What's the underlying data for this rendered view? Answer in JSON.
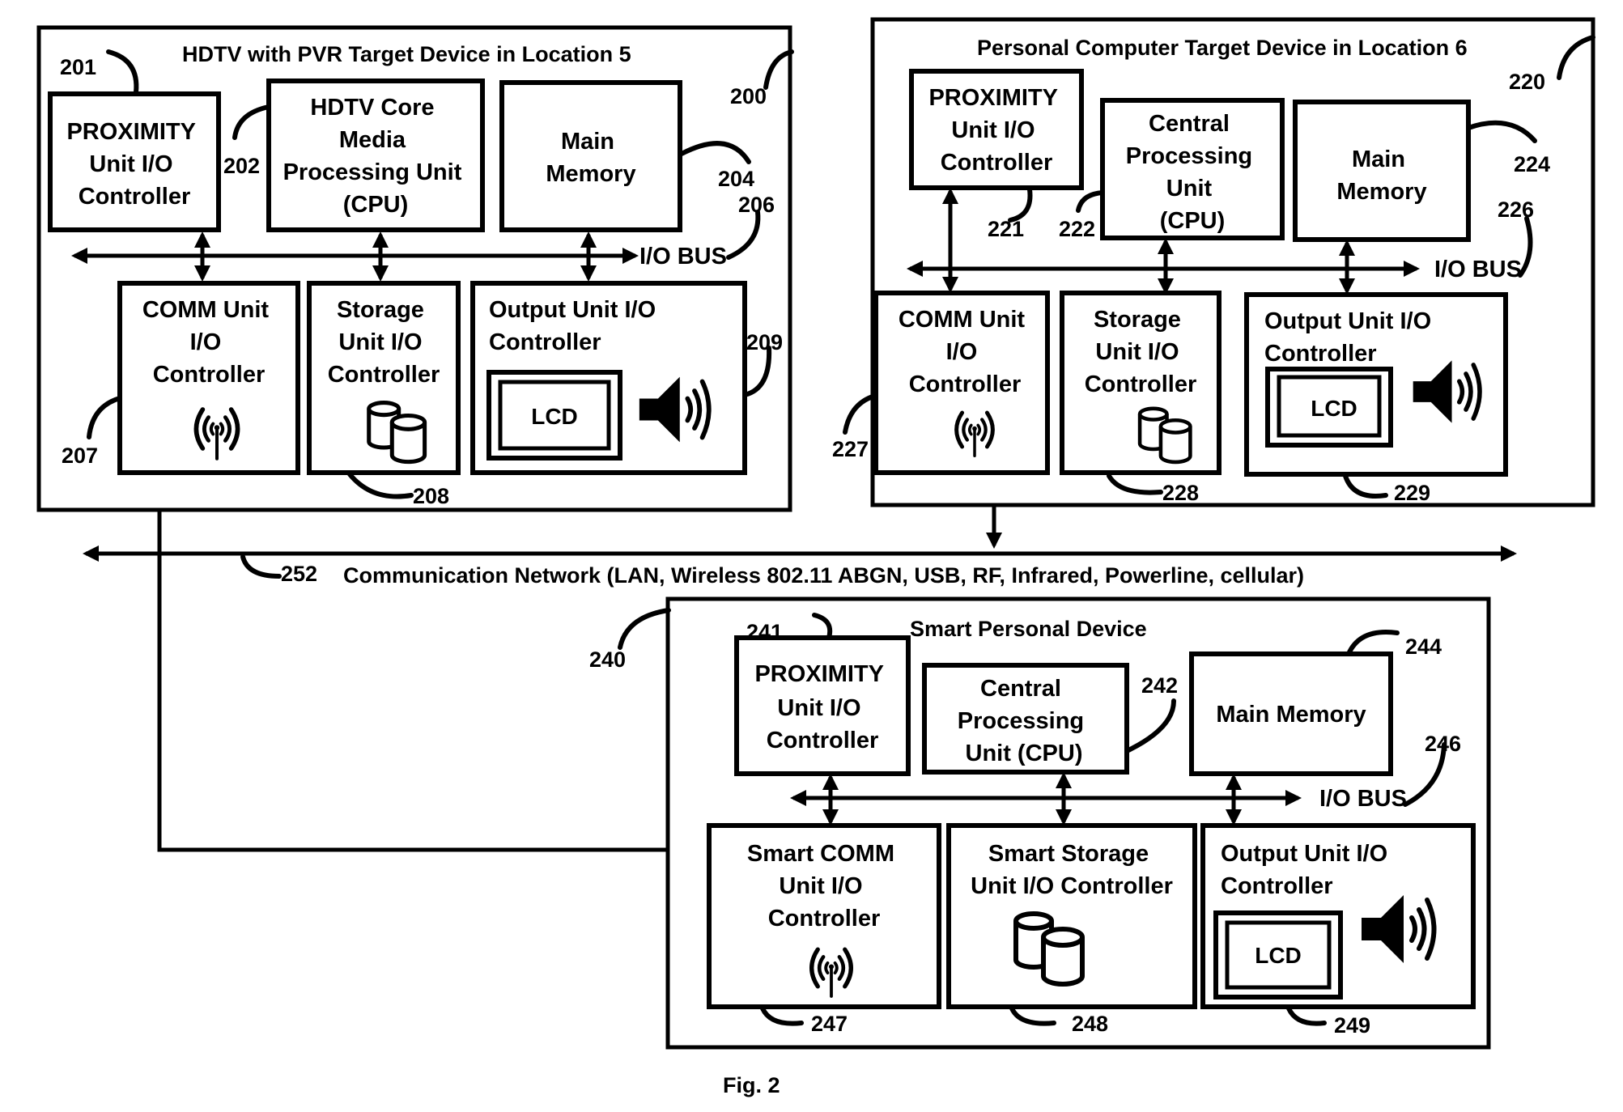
{
  "figure": {
    "caption": "Fig. 2",
    "network": {
      "ref": "252",
      "label": "Communication Network (LAN, Wireless 802.11 ABGN, USB, RF, Infrared, Powerline, cellular)"
    },
    "devices": {
      "hdtv": {
        "ref": "200",
        "title": "HDTV with PVR Target Device  in Location 5",
        "bus": {
          "label": "I/O BUS",
          "ref": "206"
        },
        "proximity": {
          "ref": "201",
          "lines": [
            "PROXIMITY",
            "Unit I/O",
            "Controller"
          ]
        },
        "cpu": {
          "ref": "202",
          "lines": [
            "HDTV Core",
            "Media",
            "Processing Unit",
            "(CPU)"
          ]
        },
        "memory": {
          "ref": "204",
          "lines": [
            "Main",
            "Memory"
          ]
        },
        "comm": {
          "ref": "207",
          "lines": [
            "COMM Unit",
            "I/O",
            "Controller"
          ],
          "icon": "wireless-antenna-icon"
        },
        "storage": {
          "ref": "208",
          "lines": [
            "Storage",
            "Unit I/O",
            "Controller"
          ],
          "icon": "database-cylinders-icon"
        },
        "output": {
          "ref": "209",
          "lines": [
            "Output Unit  I/O",
            "Controller"
          ],
          "lcd": "LCD",
          "icon": "speaker-icon"
        }
      },
      "pc": {
        "ref": "220",
        "title": "Personal Computer Target Device  in Location 6",
        "bus": {
          "label": "I/O BUS",
          "ref": "226"
        },
        "proximity": {
          "ref": "221",
          "lines": [
            "PROXIMITY",
            "Unit I/O",
            "Controller"
          ]
        },
        "cpu": {
          "ref": "222",
          "lines": [
            "Central",
            "Processing",
            "Unit",
            "(CPU)"
          ]
        },
        "memory": {
          "ref": "224",
          "lines": [
            "Main",
            "Memory"
          ]
        },
        "comm": {
          "ref": "227",
          "lines": [
            "COMM Unit",
            "I/O",
            "Controller"
          ],
          "icon": "wireless-antenna-icon"
        },
        "storage": {
          "ref": "228",
          "lines": [
            "Storage",
            "Unit I/O",
            "Controller"
          ],
          "icon": "database-cylinders-icon"
        },
        "output": {
          "ref": "229",
          "lines": [
            "Output Unit I/O",
            "Controller"
          ],
          "lcd": "LCD",
          "icon": "speaker-icon"
        }
      },
      "smart": {
        "ref": "240",
        "title": "Smart Personal Device",
        "bus": {
          "label": "I/O BUS",
          "ref": "246"
        },
        "proximity": {
          "ref": "241",
          "lines": [
            "PROXIMITY",
            "Unit I/O",
            "Controller"
          ]
        },
        "cpu": {
          "ref": "242",
          "lines": [
            "Central",
            "Processing",
            "Unit (CPU)"
          ]
        },
        "memory": {
          "ref": "244",
          "lines": [
            "Main Memory"
          ]
        },
        "comm": {
          "ref": "247",
          "lines": [
            "Smart COMM",
            "Unit I/O",
            "Controller"
          ],
          "icon": "wireless-antenna-icon"
        },
        "storage": {
          "ref": "248",
          "lines": [
            "Smart Storage",
            "Unit I/O Controller"
          ],
          "icon": "database-cylinders-icon"
        },
        "output": {
          "ref": "249",
          "lines": [
            "Output Unit I/O",
            "Controller"
          ],
          "lcd": "LCD",
          "icon": "speaker-icon"
        }
      }
    }
  }
}
